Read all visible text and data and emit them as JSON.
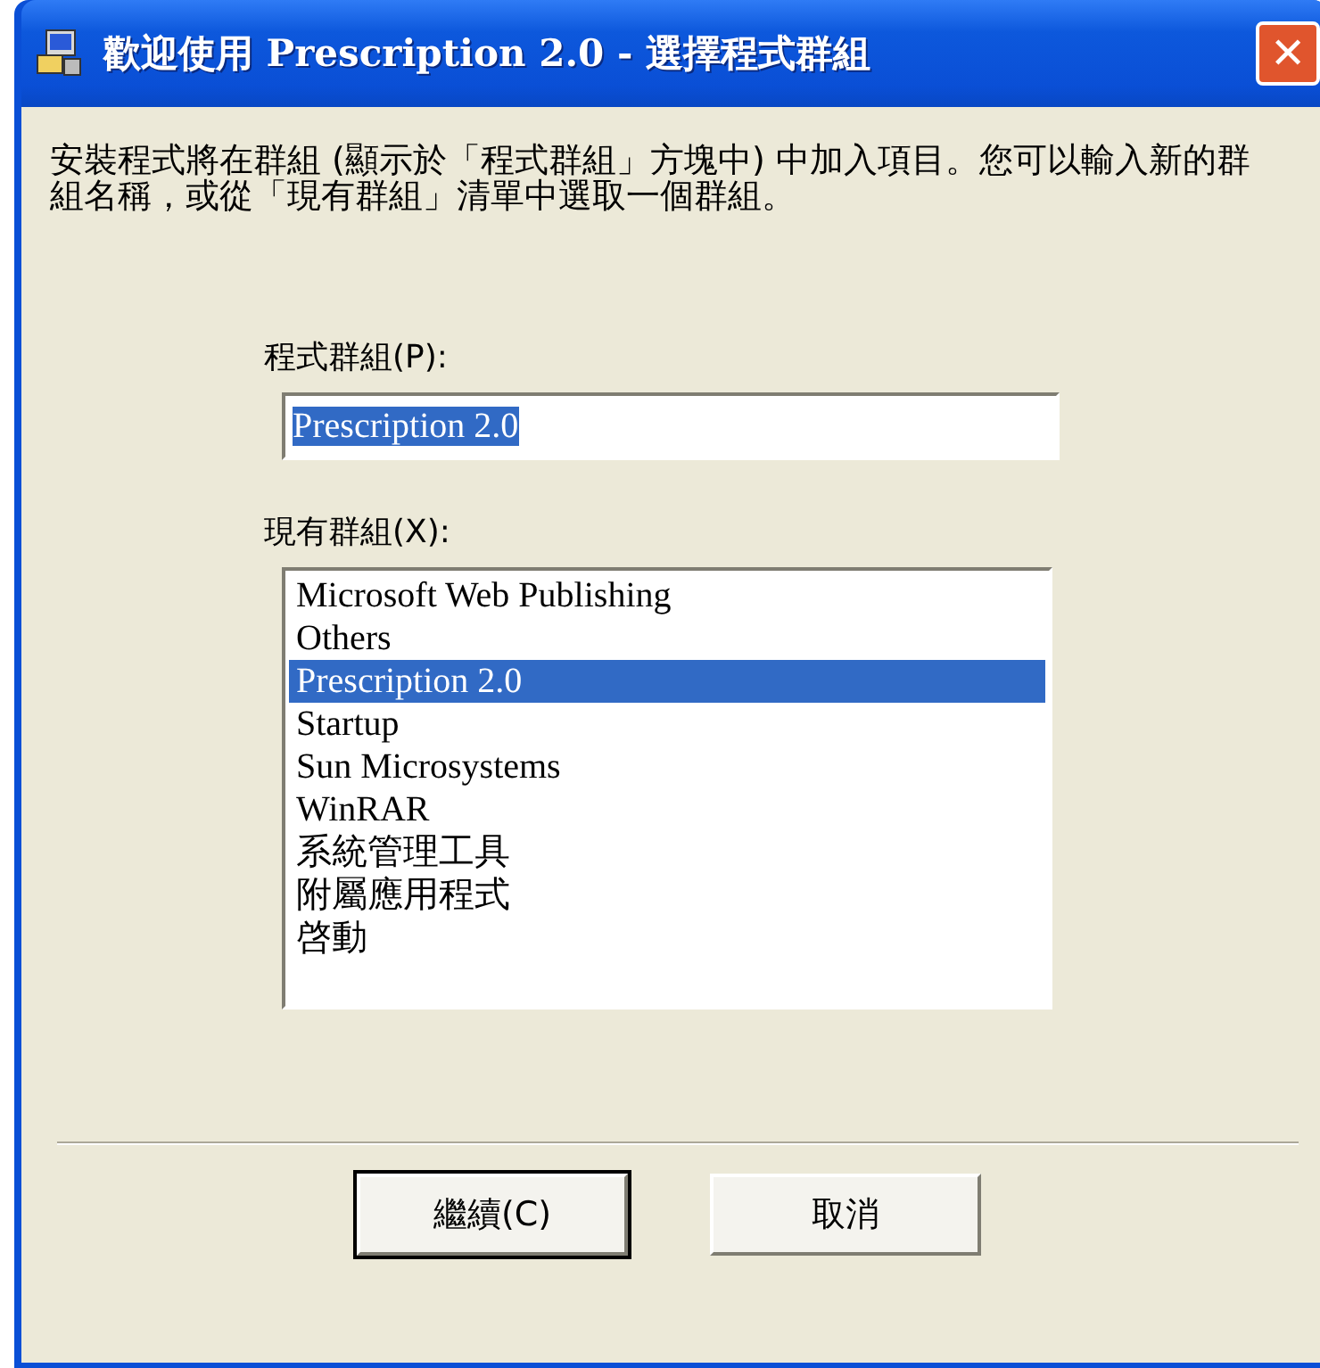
{
  "window": {
    "title": "歡迎使用 Prescription 2.0 - 選擇程式群組",
    "close": "✕"
  },
  "description": "安裝程式將在群組 (顯示於「程式群組」方塊中) 中加入項目。您可以輸入新的群組名稱，或從「現有群組」清單中選取一個群組。",
  "program_group": {
    "label": "程式群組(P):",
    "value": "Prescription 2.0",
    "value_selected": true
  },
  "existing_groups": {
    "label": "現有群組(X):",
    "items": [
      {
        "label": "Microsoft Web Publishing",
        "selected": false
      },
      {
        "label": "Others",
        "selected": false
      },
      {
        "label": "Prescription 2.0",
        "selected": true
      },
      {
        "label": "Startup",
        "selected": false
      },
      {
        "label": "Sun Microsystems",
        "selected": false
      },
      {
        "label": "WinRAR",
        "selected": false
      },
      {
        "label": "系統管理工具",
        "selected": false
      },
      {
        "label": "附屬應用程式",
        "selected": false
      },
      {
        "label": "啓動",
        "selected": false
      }
    ]
  },
  "buttons": [
    {
      "label": "繼續(C)",
      "default": true
    },
    {
      "label": "取消",
      "default": false
    }
  ]
}
